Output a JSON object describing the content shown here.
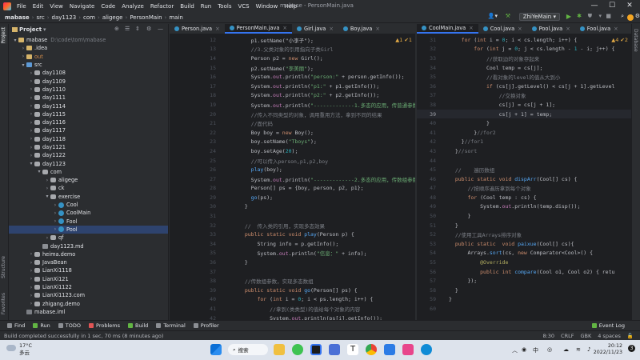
{
  "menubar": {
    "items": [
      "File",
      "Edit",
      "View",
      "Navigate",
      "Code",
      "Analyze",
      "Refactor",
      "Build",
      "Run",
      "Tools",
      "VCS",
      "Window",
      "Help"
    ],
    "window_title": "mabase - PersonMain.java",
    "minimize": "—",
    "maximize": "☐",
    "close": "✕"
  },
  "navbar": {
    "breadcrumbs": [
      "mabase",
      "src",
      "day1123",
      "com",
      "aligege",
      "PersonMain",
      "main"
    ],
    "run_config": "ZhiYeMain"
  },
  "left_strip": {
    "project": "Project",
    "structure": "Structure",
    "favorites": "Favorites"
  },
  "right_strip": {
    "database": "Database"
  },
  "project_panel": {
    "title": "Project",
    "tree": [
      {
        "depth": 0,
        "arrow": "▾",
        "icon": "folder",
        "label": "mabase",
        "hint": "D:\\code\\tom\\mabase"
      },
      {
        "depth": 1,
        "arrow": "›",
        "icon": "folder",
        "label": ".idea"
      },
      {
        "depth": 1,
        "arrow": "›",
        "icon": "folder",
        "label": "out",
        "orange": true
      },
      {
        "depth": 1,
        "arrow": "▾",
        "icon": "src",
        "label": "src"
      },
      {
        "depth": 2,
        "arrow": "›",
        "icon": "pkg",
        "label": "day1108"
      },
      {
        "depth": 2,
        "arrow": "›",
        "icon": "pkg",
        "label": "day1109"
      },
      {
        "depth": 2,
        "arrow": "›",
        "icon": "pkg",
        "label": "day1110"
      },
      {
        "depth": 2,
        "arrow": "›",
        "icon": "pkg",
        "label": "day1111"
      },
      {
        "depth": 2,
        "arrow": "›",
        "icon": "pkg",
        "label": "day1114"
      },
      {
        "depth": 2,
        "arrow": "›",
        "icon": "pkg",
        "label": "day1115"
      },
      {
        "depth": 2,
        "arrow": "›",
        "icon": "pkg",
        "label": "day1116"
      },
      {
        "depth": 2,
        "arrow": "›",
        "icon": "pkg",
        "label": "day1117"
      },
      {
        "depth": 2,
        "arrow": "›",
        "icon": "pkg",
        "label": "day1118"
      },
      {
        "depth": 2,
        "arrow": "›",
        "icon": "pkg",
        "label": "day1121"
      },
      {
        "depth": 2,
        "arrow": "›",
        "icon": "pkg",
        "label": "day1122"
      },
      {
        "depth": 2,
        "arrow": "▾",
        "icon": "pkg",
        "label": "day1123"
      },
      {
        "depth": 3,
        "arrow": "▾",
        "icon": "pkg",
        "label": "com"
      },
      {
        "depth": 4,
        "arrow": "›",
        "icon": "pkg",
        "label": "aligege"
      },
      {
        "depth": 4,
        "arrow": "›",
        "icon": "pkg",
        "label": "ck"
      },
      {
        "depth": 4,
        "arrow": "▾",
        "icon": "pkg",
        "label": "exercise"
      },
      {
        "depth": 5,
        "arrow": "›",
        "icon": "cls",
        "label": "Cool"
      },
      {
        "depth": 5,
        "arrow": "›",
        "icon": "cls",
        "label": "CoolMain"
      },
      {
        "depth": 5,
        "arrow": "›",
        "icon": "cls",
        "label": "Fool"
      },
      {
        "depth": 5,
        "arrow": "›",
        "icon": "cls",
        "label": "Pool",
        "selected": true
      },
      {
        "depth": 4,
        "arrow": "›",
        "icon": "pkg",
        "label": "qf"
      },
      {
        "depth": 3,
        "arrow": "",
        "icon": "md",
        "label": "day1123.md"
      },
      {
        "depth": 2,
        "arrow": "›",
        "icon": "pkg",
        "label": "heima.demo"
      },
      {
        "depth": 2,
        "arrow": "›",
        "icon": "pkg",
        "label": "JavaBean"
      },
      {
        "depth": 2,
        "arrow": "›",
        "icon": "pkg",
        "label": "LianXi1118"
      },
      {
        "depth": 2,
        "arrow": "›",
        "icon": "pkg",
        "label": "LianXi121"
      },
      {
        "depth": 2,
        "arrow": "›",
        "icon": "pkg",
        "label": "LianXi1122"
      },
      {
        "depth": 2,
        "arrow": "›",
        "icon": "pkg",
        "label": "LianXi1123.com"
      },
      {
        "depth": 2,
        "arrow": "›",
        "icon": "pkg",
        "label": "zhigang.demo"
      },
      {
        "depth": 1,
        "arrow": "",
        "icon": "iml",
        "label": "mabase.iml"
      }
    ]
  },
  "editor_left": {
    "tabs": [
      {
        "label": "Person.java",
        "active": false
      },
      {
        "label": "PersonMain.java",
        "active": true
      },
      {
        "label": "Girl.java",
        "active": false
      },
      {
        "label": "Boy.java",
        "active": false
      }
    ],
    "inspection": "▲1 ✔1",
    "lines": [
      {
        "n": "12",
        "code": [
          [
            "",
            "    p1.setName(\"小李子\");"
          ]
        ]
      },
      {
        "n": "13",
        "code": [
          [
            "cmt",
            "    //3.父类对象的引用指向子类Girl"
          ]
        ]
      },
      {
        "n": "14",
        "code": [
          [
            "",
            "    Person p2 = "
          ],
          [
            "kw",
            "new "
          ],
          [
            "",
            "Girl();"
          ]
        ]
      },
      {
        "n": "15",
        "code": [
          [
            "",
            "    p2.setName("
          ],
          [
            "str",
            "\"李美丽\""
          ],
          [
            "",
            ");"
          ]
        ]
      },
      {
        "n": "16",
        "code": [
          [
            "",
            "    System."
          ],
          [
            "fld",
            "out"
          ],
          [
            "",
            ".println("
          ],
          [
            "str",
            "\"person:\""
          ],
          [
            "",
            " + person.getInfo());"
          ]
        ]
      },
      {
        "n": "17",
        "code": [
          [
            "",
            "    System."
          ],
          [
            "fld",
            "out"
          ],
          [
            "",
            ".println("
          ],
          [
            "str",
            "\"p1:\""
          ],
          [
            "",
            " + p1.getInfo());"
          ]
        ]
      },
      {
        "n": "18",
        "code": [
          [
            "",
            "    System."
          ],
          [
            "fld",
            "out"
          ],
          [
            "",
            ".println("
          ],
          [
            "str",
            "\"p2:\""
          ],
          [
            "",
            " + p2.getInfo());"
          ]
        ]
      },
      {
        "n": "19",
        "code": [
          [
            "",
            "    System."
          ],
          [
            "fld",
            "out"
          ],
          [
            "",
            ".println("
          ],
          [
            "str",
            "\"-------------1.多态的应用，传普通参数------\""
          ],
          [
            "",
            " "
          ]
        ]
      },
      {
        "n": "20",
        "code": [
          [
            "cmt",
            "    //传入不同类型的对象，调用重用方法，拿到不同的结果"
          ]
        ]
      },
      {
        "n": "21",
        "code": [
          [
            "cmt",
            "    //面代码"
          ]
        ]
      },
      {
        "n": "22",
        "code": [
          [
            "",
            "    Boy boy = "
          ],
          [
            "kw",
            "new "
          ],
          [
            "",
            "Boy();"
          ]
        ]
      },
      {
        "n": "23",
        "code": [
          [
            "",
            "    boy.setName("
          ],
          [
            "str",
            "\"T"
          ],
          [
            "str",
            "boys\""
          ],
          [
            "",
            ");"
          ]
        ]
      },
      {
        "n": "24",
        "code": [
          [
            "",
            "    boy.setAge("
          ],
          [
            "num-l",
            "20"
          ],
          [
            "",
            ");"
          ]
        ]
      },
      {
        "n": "25",
        "code": [
          [
            "cmt",
            "    //可以传入person,p1,p2,boy"
          ]
        ]
      },
      {
        "n": "26",
        "code": [
          [
            "",
            "    "
          ],
          [
            "fn",
            "play"
          ],
          [
            "",
            "(boy);"
          ]
        ]
      },
      {
        "n": "27",
        "code": [
          [
            "",
            "    System."
          ],
          [
            "fld",
            "out"
          ],
          [
            "",
            ".println("
          ],
          [
            "str",
            "\"-------------2.多态的应用，传数组参数实现多态\""
          ]
        ]
      },
      {
        "n": "28",
        "code": [
          [
            "",
            "    Person[] ps = {boy, person, p2, p1};"
          ]
        ]
      },
      {
        "n": "29",
        "code": [
          [
            "",
            "    "
          ],
          [
            "fn",
            "go"
          ],
          [
            "",
            "(ps);"
          ]
        ]
      },
      {
        "n": "30",
        "code": [
          [
            "",
            "  }"
          ]
        ]
      },
      {
        "n": "31",
        "code": [
          [
            "",
            ""
          ]
        ]
      },
      {
        "n": "32",
        "code": [
          [
            "cmt",
            "  //  传入类的引用，实现多态效果"
          ]
        ]
      },
      {
        "n": "33",
        "code": [
          [
            "kw",
            "  public static void "
          ],
          [
            "fn",
            "play"
          ],
          [
            "",
            "(Person p) {"
          ]
        ]
      },
      {
        "n": "34",
        "code": [
          [
            "",
            "      String info = p.getInfo();"
          ]
        ]
      },
      {
        "n": "35",
        "code": [
          [
            "",
            "      System."
          ],
          [
            "fld",
            "out"
          ],
          [
            "",
            ".println("
          ],
          [
            "str",
            "\"信息：\""
          ],
          [
            "",
            " + info);"
          ]
        ]
      },
      {
        "n": "36",
        "code": [
          [
            "",
            "  }"
          ]
        ]
      },
      {
        "n": "37",
        "code": [
          [
            "",
            ""
          ]
        ]
      },
      {
        "n": "38",
        "code": [
          [
            "cmt",
            "  //传数组参数，实现多态数组"
          ]
        ]
      },
      {
        "n": "39",
        "code": [
          [
            "kw",
            "  public static void "
          ],
          [
            "fn",
            "go"
          ],
          [
            "",
            "(Person[] ps) {"
          ]
        ]
      },
      {
        "n": "40",
        "code": [
          [
            "kw",
            "      for "
          ],
          [
            "",
            "("
          ],
          [
            "kw",
            "int "
          ],
          [
            "",
            "i = "
          ],
          [
            "num-l",
            "0"
          ],
          [
            "",
            "; i < ps.length; i++) {"
          ]
        ]
      },
      {
        "n": "41",
        "code": [
          [
            "cmt",
            "          //拿到(类类型)的值给每个对象的内容"
          ]
        ]
      },
      {
        "n": "42",
        "code": [
          [
            "",
            "          System."
          ],
          [
            "fld",
            "out"
          ],
          [
            "",
            ".println(ps[i].getInfo());"
          ]
        ]
      }
    ]
  },
  "editor_right": {
    "tabs": [
      {
        "label": "CoolMain.java",
        "active": true
      },
      {
        "label": "Cool.java",
        "active": false
      },
      {
        "label": "Pool.java",
        "active": false
      },
      {
        "label": "Fool.java",
        "active": false
      }
    ],
    "inspection": "▲4 ✔2",
    "lines": [
      {
        "n": "31",
        "code": [
          [
            "kw",
            "    for "
          ],
          [
            "",
            "("
          ],
          [
            "kw",
            "int "
          ],
          [
            "",
            "i = "
          ],
          [
            "num-l",
            "0"
          ],
          [
            "",
            "; i < cs.length; i++) {"
          ]
        ]
      },
      {
        "n": "32",
        "code": [
          [
            "kw",
            "        for "
          ],
          [
            "",
            "("
          ],
          [
            "kw",
            "int "
          ],
          [
            "",
            "j = "
          ],
          [
            "num-l",
            "0"
          ],
          [
            "",
            "; j < cs.length - "
          ],
          [
            "num-l",
            "1"
          ],
          [
            "",
            " - i; j++) {"
          ]
        ]
      },
      {
        "n": "33",
        "code": [
          [
            "cmt",
            "            //获取边的对象存起来"
          ]
        ]
      },
      {
        "n": "34",
        "code": [
          [
            "",
            "            Cool temp = cs[j];"
          ]
        ]
      },
      {
        "n": "35",
        "code": [
          [
            "cmt",
            "            //看对象的level的值从大到小"
          ]
        ]
      },
      {
        "n": "36",
        "code": [
          [
            "kw",
            "            if "
          ],
          [
            "",
            "(cs[j].getLevel() < cs[j + 1].getLevel"
          ]
        ]
      },
      {
        "n": "37",
        "code": [
          [
            "cmt",
            "                //交换对象"
          ]
        ]
      },
      {
        "n": "38",
        "code": [
          [
            "",
            "                cs[j] = cs[j + 1];"
          ]
        ]
      },
      {
        "n": "39",
        "code": [
          [
            "",
            "                cs[j + 1] = temp;"
          ]
        ],
        "current": true
      },
      {
        "n": "40",
        "code": [
          [
            "",
            "            }"
          ]
        ]
      },
      {
        "n": "41",
        "code": [
          [
            "",
            "        }"
          ],
          [
            "cmt",
            "//for2"
          ]
        ]
      },
      {
        "n": "42",
        "code": [
          [
            "",
            "    }"
          ],
          [
            "cmt",
            "//for1"
          ]
        ]
      },
      {
        "n": "43",
        "code": [
          [
            "",
            "  }"
          ],
          [
            "cmt",
            "//sort"
          ]
        ]
      },
      {
        "n": "44",
        "code": [
          [
            "",
            ""
          ]
        ]
      },
      {
        "n": "45",
        "code": [
          [
            "cmt",
            "  //    遍历数组"
          ]
        ]
      },
      {
        "n": "46",
        "code": [
          [
            "kw",
            "  public static void "
          ],
          [
            "fn",
            "dispArr"
          ],
          [
            "",
            "(Cool[] cs) {"
          ]
        ]
      },
      {
        "n": "47",
        "code": [
          [
            "cmt",
            "      //按顺序遍历拿到每个对象"
          ]
        ]
      },
      {
        "n": "48",
        "code": [
          [
            "kw",
            "      for "
          ],
          [
            "",
            "(Cool temp : cs) {"
          ]
        ]
      },
      {
        "n": "49",
        "code": [
          [
            "",
            "          System."
          ],
          [
            "fld",
            "out"
          ],
          [
            "",
            ".println(temp.disp());"
          ]
        ]
      },
      {
        "n": "50",
        "code": [
          [
            "",
            "      }"
          ]
        ]
      },
      {
        "n": "51",
        "code": [
          [
            "",
            "  }"
          ]
        ]
      },
      {
        "n": "52",
        "code": [
          [
            "cmt",
            "  //使用工具Arrays排序对象"
          ]
        ]
      },
      {
        "n": "53",
        "code": [
          [
            "kw",
            "  public static  void "
          ],
          [
            "fn",
            "paixue"
          ],
          [
            "",
            "(Cool[] cs){"
          ]
        ]
      },
      {
        "n": "54",
        "code": [
          [
            "",
            "      Arrays."
          ],
          [
            "fn",
            "sort"
          ],
          [
            "",
            "(cs, "
          ],
          [
            "kw",
            "new "
          ],
          [
            "",
            "Comparator<Cool>() {"
          ]
        ]
      },
      {
        "n": "55",
        "code": [
          [
            "ann",
            "          @Override"
          ]
        ]
      },
      {
        "n": "56",
        "code": [
          [
            "kw",
            "          public int "
          ],
          [
            "fn",
            "compare"
          ],
          [
            "",
            "(Cool o1, Cool o2) { retu"
          ]
        ]
      },
      {
        "n": "57",
        "code": [
          [
            "",
            "      });"
          ]
        ]
      },
      {
        "n": "58",
        "code": [
          [
            "",
            "  }"
          ]
        ]
      },
      {
        "n": "59",
        "code": [
          [
            "",
            "}"
          ]
        ]
      },
      {
        "n": "60",
        "code": [
          [
            "",
            ""
          ]
        ]
      }
    ]
  },
  "toolwindows": [
    "Find",
    "Run",
    "TODO",
    "Problems",
    "Build",
    "Terminal",
    "Profiler"
  ],
  "event_log": "Event Log",
  "status": {
    "message": "Build completed successfully in 1 sec, 70 ms (8 minutes ago)",
    "position": "8:30",
    "line_sep": "CRLF",
    "encoding": "GBK",
    "indent": "4 spaces"
  },
  "taskbar": {
    "temperature": "17°C",
    "weather": "多云",
    "search": "搜索",
    "time": "20:12",
    "date": "2022/11/23",
    "lang": "中"
  }
}
